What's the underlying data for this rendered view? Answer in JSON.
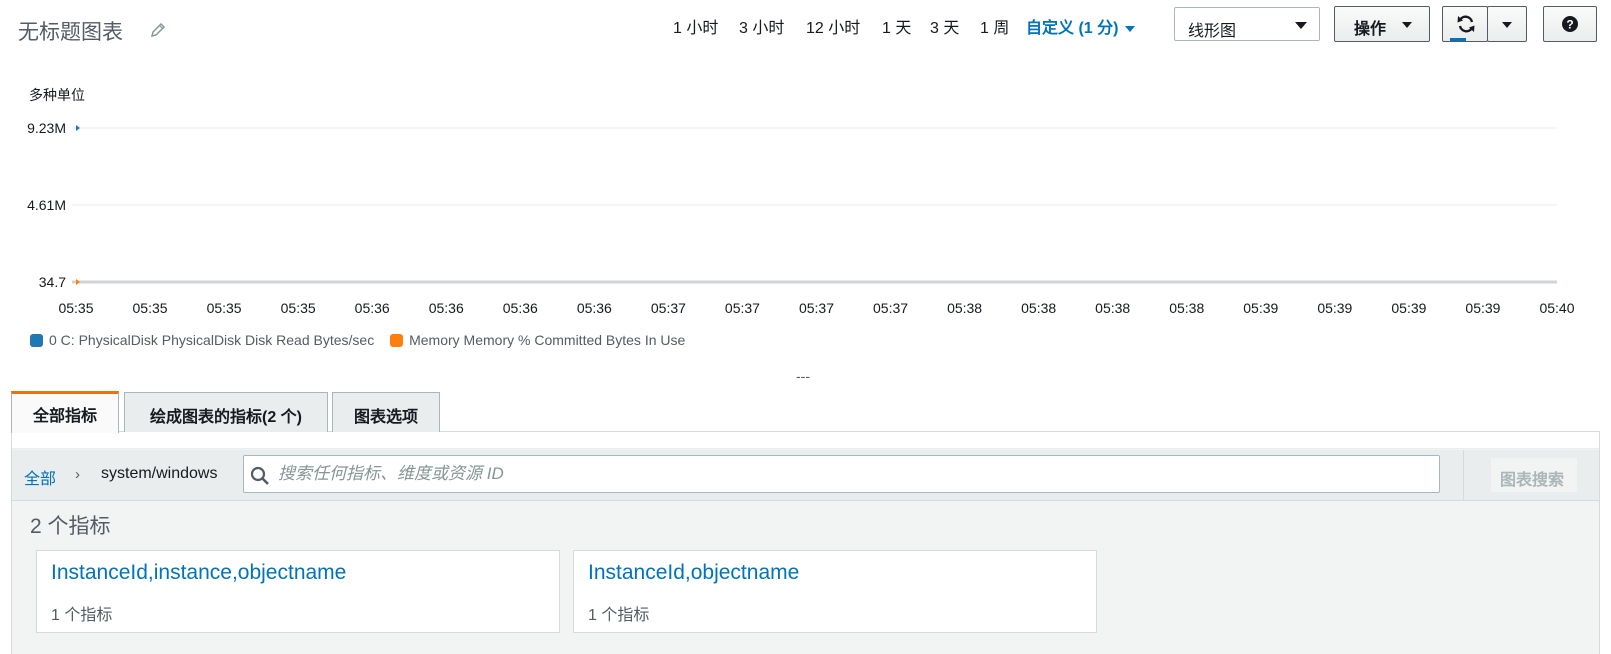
{
  "header": {
    "title": "无标题图表",
    "time_ranges": [
      "1 小时",
      "3 小时",
      "12 小时",
      "1 天",
      "3 天",
      "1 周"
    ],
    "custom_range": "自定义 (1 分)",
    "chart_type": "线形图",
    "actions_label": "操作"
  },
  "chart_data": {
    "type": "line",
    "y_axis_label": "多种单位",
    "y_ticks": [
      "9.23M",
      "4.61M",
      "34.7"
    ],
    "x_ticks": [
      "05:35",
      "05:35",
      "05:35",
      "05:35",
      "05:36",
      "05:36",
      "05:36",
      "05:36",
      "05:37",
      "05:37",
      "05:37",
      "05:37",
      "05:38",
      "05:38",
      "05:38",
      "05:38",
      "05:39",
      "05:39",
      "05:39",
      "05:39",
      "05:40"
    ],
    "series": [
      {
        "name": "0 C: PhysicalDisk PhysicalDisk Disk Read Bytes/sec",
        "color": "#1f77b4",
        "values": [
          9230000
        ]
      },
      {
        "name": "Memory Memory % Committed Bytes In Use",
        "color": "#ff7f0e",
        "values": [
          34.7
        ]
      }
    ]
  },
  "divider_label": "---",
  "tabs": {
    "all": "全部指标",
    "graphed": "绘成图表的指标(2 个)",
    "options": "图表选项"
  },
  "browser": {
    "breadcrumb_root": "全部",
    "breadcrumb_sep": "›",
    "namespace": "system/windows",
    "search_placeholder": "搜索任何指标、维度或资源 ID",
    "graph_search": "图表搜索",
    "metric_count": "2 个指标",
    "cards": [
      {
        "title": "InstanceId,instance,objectname",
        "subtitle": "1 个指标"
      },
      {
        "title": "InstanceId,objectname",
        "subtitle": "1 个指标"
      }
    ]
  }
}
